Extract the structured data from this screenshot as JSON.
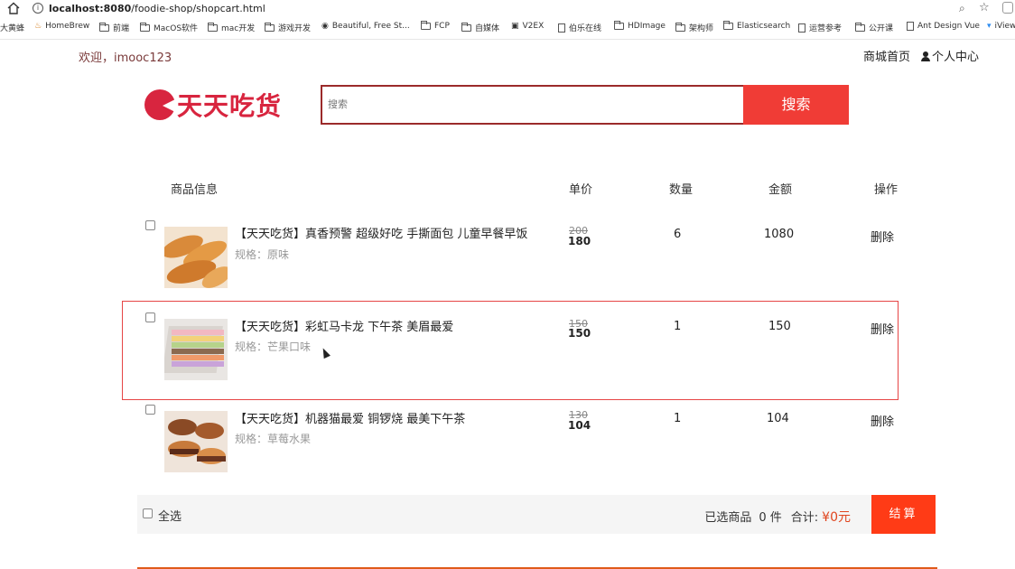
{
  "browser": {
    "url_host": "localhost:8080",
    "url_path": "/foodie-shop/shopcart.html",
    "bookmarks": [
      "大黄蜂",
      "HomeBrew",
      "前端",
      "MacOS软件",
      "mac开发",
      "游戏开发",
      "Beautiful, Free St...",
      "FCP",
      "自媒体",
      "V2EX",
      "伯乐在线",
      "HDImage",
      "架构师",
      "Elasticsearch",
      "运营参考",
      "公开课",
      "Ant Design Vue",
      "iView"
    ]
  },
  "header": {
    "welcome": "欢迎，imooc123",
    "links": {
      "home": "商城首页",
      "user_center": "个人中心"
    },
    "logo_text": "天天吃货",
    "search_placeholder": "搜索",
    "search_button": "搜索"
  },
  "table_headers": {
    "info": "商品信息",
    "unit_price": "单价",
    "quantity": "数量",
    "amount": "金额",
    "action": "操作"
  },
  "cart_items": [
    {
      "name": "【天天吃货】真香预警 超级好吃 手撕面包 儿童早餐早饭",
      "spec": "规格：原味",
      "old_price": "200",
      "price": "180",
      "quantity": "6",
      "amount": "1080",
      "delete_label": "删除"
    },
    {
      "name": "【天天吃货】彩虹马卡龙 下午茶 美眉最爱",
      "spec": "规格：芒果口味",
      "old_price": "150",
      "price": "150",
      "quantity": "1",
      "amount": "150",
      "delete_label": "删除"
    },
    {
      "name": "【天天吃货】机器猫最爱 铜锣烧 最美下午茶",
      "spec": "规格：草莓水果",
      "old_price": "130",
      "price": "104",
      "quantity": "1",
      "amount": "104",
      "delete_label": "删除"
    }
  ],
  "footer": {
    "select_all": "全选",
    "selected_label": "已选商品",
    "selected_count": "0 件",
    "total_label": "合计:",
    "total_value": "¥0元",
    "checkout": "结算"
  },
  "colors": {
    "brand_red": "#d8253f",
    "search_btn": "#f03c36",
    "checkout": "#ff3b16",
    "row_highlight": "#e64545"
  }
}
